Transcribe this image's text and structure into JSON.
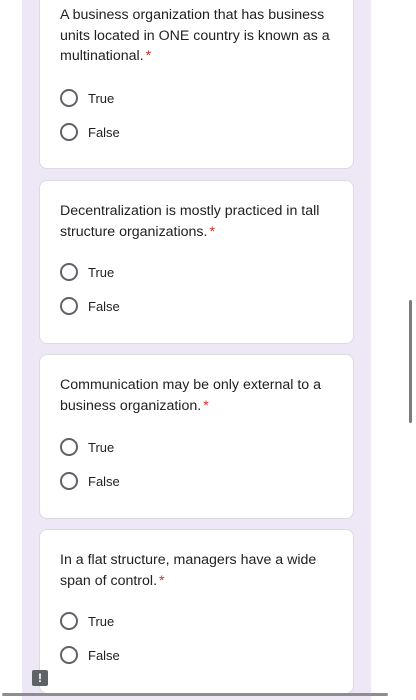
{
  "questions": [
    {
      "text": "A business organization that has business units located in ONE country is known as a multinational.",
      "required_mark": "*",
      "options": [
        "True",
        "False"
      ]
    },
    {
      "text": "Decentralization is mostly practiced in tall structure organizations.",
      "required_mark": "*",
      "options": [
        "True",
        "False"
      ]
    },
    {
      "text": "Communication may be only external to a business organization.",
      "required_mark": "*",
      "options": [
        "True",
        "False"
      ]
    },
    {
      "text": "In a flat structure, managers have a wide span of control.",
      "required_mark": "*",
      "options": [
        "True",
        "False"
      ]
    }
  ],
  "feedback_button": {
    "icon": "exclamation-icon",
    "glyph": "!"
  },
  "colors": {
    "background_band": "#ede7f6",
    "card_border": "#dadce0",
    "required": "#d93025",
    "radio_border": "#5f6368",
    "text": "#202124"
  }
}
